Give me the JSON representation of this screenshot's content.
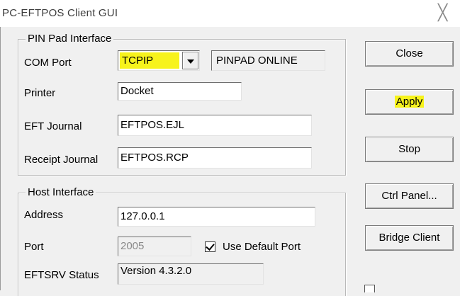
{
  "window": {
    "title": "PC-EFTPOS Client GUI",
    "close_glyph": "╳"
  },
  "pinpad": {
    "legend": "PIN Pad Interface",
    "com_port_label": "COM Port",
    "com_port_value": "TCPIP",
    "status_value": "PINPAD ONLINE",
    "printer_label": "Printer",
    "printer_value": "Docket",
    "eft_journal_label": "EFT Journal",
    "eft_journal_value": "EFTPOS.EJL",
    "receipt_journal_label": "Receipt Journal",
    "receipt_journal_value": "EFTPOS.RCP"
  },
  "host": {
    "legend": "Host Interface",
    "address_label": "Address",
    "address_value": "127.0.0.1",
    "port_label": "Port",
    "port_value": "2005",
    "use_default_port_label": "Use Default Port",
    "use_default_port_checked": true,
    "eftsrv_status_label": "EFTSRV Status",
    "eftsrv_status_value": "Version 4.3.2.0"
  },
  "buttons": {
    "close": "Close",
    "apply": "Apply",
    "stop": "Stop",
    "ctrl_panel": "Ctrl Panel...",
    "bridge_client": "Bridge Client"
  },
  "colors": {
    "highlight": "#f7f31c"
  }
}
